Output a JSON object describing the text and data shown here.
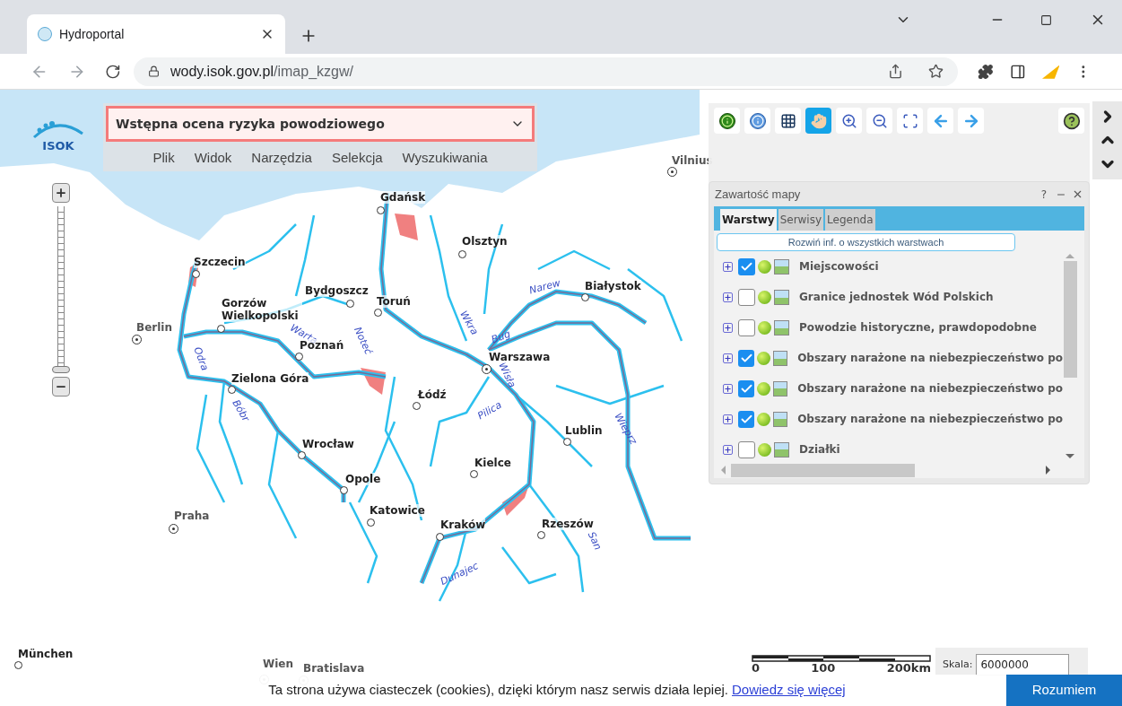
{
  "browser": {
    "tab_title": "Hydroportal",
    "url_host": "wody.isok.gov.pl",
    "url_path": "/imap_kzgw/"
  },
  "logo": {
    "text": "ISOK"
  },
  "map_selector": {
    "value": "Wstępna ocena ryzyka powodziowego"
  },
  "menu": [
    "Plik",
    "Widok",
    "Narzędzia",
    "Selekcja",
    "Wyszukiwania"
  ],
  "zoom_slider": {
    "level": 0.02
  },
  "toolbar": [
    {
      "kind": "identify",
      "selected": false
    },
    {
      "kind": "info",
      "selected": false
    },
    {
      "kind": "select",
      "selected": false
    },
    {
      "kind": "pan",
      "selected": true
    },
    {
      "kind": "zoom-in",
      "selected": false
    },
    {
      "kind": "zoom-out",
      "selected": false
    },
    {
      "kind": "zoom-extent",
      "selected": false
    },
    {
      "kind": "back",
      "selected": false
    },
    {
      "kind": "forward",
      "selected": false
    }
  ],
  "map_contents": {
    "title": "Zawartość mapy",
    "help": "?",
    "tabs": [
      {
        "label": "Warstwy",
        "selected": true
      },
      {
        "label": "Serwisy",
        "selected": false
      },
      {
        "label": "Legenda",
        "selected": false
      }
    ],
    "expand_all": "Rozwiń inf. o wszystkich warstwach",
    "layers": [
      {
        "name": "Miejscowości",
        "checked": true
      },
      {
        "name": "Granice jednostek Wód Polskich",
        "checked": false
      },
      {
        "name": "Powodzie historyczne, prawdopodobne",
        "checked": false
      },
      {
        "name": "Obszary narażone na niebezpieczeństwo po",
        "checked": true
      },
      {
        "name": "Obszary narażone na niebezpieczeństwo po",
        "checked": true
      },
      {
        "name": "Obszary narażone na niebezpieczeństwo po",
        "checked": true
      },
      {
        "name": "Działki",
        "checked": false
      }
    ]
  },
  "map": {
    "cities": [
      {
        "name": "Gdańsk",
        "kind": "city"
      },
      {
        "name": "Olsztyn",
        "kind": "city"
      },
      {
        "name": "Szczecin",
        "kind": "city"
      },
      {
        "name": "Białystok",
        "kind": "city"
      },
      {
        "name": "Bydgoszcz",
        "kind": "city"
      },
      {
        "name": "Toruń",
        "kind": "city"
      },
      {
        "name": "Gorzów Wielkopolski",
        "kind": "city"
      },
      {
        "name": "Berlin",
        "kind": "capital"
      },
      {
        "name": "Poznań",
        "kind": "city"
      },
      {
        "name": "Warszawa",
        "kind": "capital"
      },
      {
        "name": "Zielona Góra",
        "kind": "city"
      },
      {
        "name": "Łódź",
        "kind": "city"
      },
      {
        "name": "Lublin",
        "kind": "city"
      },
      {
        "name": "Wrocław",
        "kind": "city"
      },
      {
        "name": "Kielce",
        "kind": "city"
      },
      {
        "name": "Opole",
        "kind": "city"
      },
      {
        "name": "Katowice",
        "kind": "city"
      },
      {
        "name": "Praha",
        "kind": "capital"
      },
      {
        "name": "Kraków",
        "kind": "city"
      },
      {
        "name": "Rzeszów",
        "kind": "city"
      },
      {
        "name": "Vilnius",
        "kind": "capital"
      },
      {
        "name": "München",
        "kind": "city"
      },
      {
        "name": "Wien",
        "kind": "capital"
      },
      {
        "name": "Bratislava",
        "kind": "capital"
      }
    ],
    "rivers": [
      "Narew",
      "Noteć",
      "Wkra",
      "Warta",
      "Bug",
      "Odra",
      "Wisła",
      "Pilica",
      "Bóbr",
      "Wieprz",
      "San",
      "Dunajec"
    ]
  },
  "scale": {
    "ticks": [
      "0",
      "100",
      "200km"
    ],
    "label": "Skala:",
    "value": "6000000"
  },
  "cookie_banner": {
    "text": "Ta strona używa ciasteczek (cookies), dzięki którym nasz serwis działa lepiej.",
    "link": "Dowiedz się więcej",
    "button": "Rozumiem"
  }
}
